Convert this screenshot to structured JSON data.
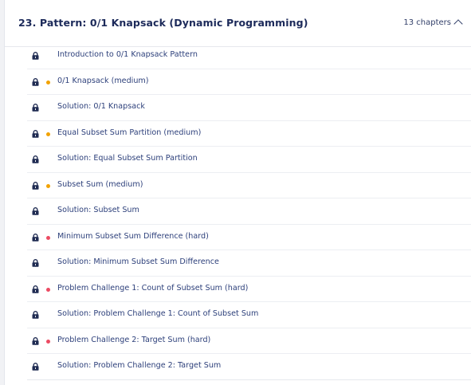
{
  "section": {
    "title": "23.  Pattern: 0/1 Knapsack (Dynamic Programming)",
    "chapters_label": "13 chapters",
    "toggle_icon": "chevron-up-icon"
  },
  "colors": {
    "medium": "#f2a200",
    "hard": "#ec4b63",
    "link": "#2c3f7a",
    "title": "#1c2a5a"
  },
  "lessons": [
    {
      "label": "Introduction to 0/1 Knapsack Pattern",
      "difficulty": "",
      "locked": true
    },
    {
      "label": "0/1 Knapsack (medium)",
      "difficulty": "medium",
      "locked": true
    },
    {
      "label": "Solution: 0/1 Knapsack",
      "difficulty": "",
      "locked": true
    },
    {
      "label": "Equal Subset Sum Partition (medium)",
      "difficulty": "medium",
      "locked": true
    },
    {
      "label": "Solution: Equal Subset Sum Partition",
      "difficulty": "",
      "locked": true
    },
    {
      "label": "Subset Sum (medium)",
      "difficulty": "medium",
      "locked": true
    },
    {
      "label": "Solution: Subset Sum",
      "difficulty": "",
      "locked": true
    },
    {
      "label": "Minimum Subset Sum Difference (hard)",
      "difficulty": "hard",
      "locked": true
    },
    {
      "label": "Solution: Minimum Subset Sum Difference",
      "difficulty": "",
      "locked": true
    },
    {
      "label": "Problem Challenge 1: Count of Subset Sum (hard)",
      "difficulty": "hard",
      "locked": true
    },
    {
      "label": "Solution: Problem Challenge 1: Count of Subset Sum",
      "difficulty": "",
      "locked": true
    },
    {
      "label": "Problem Challenge 2: Target Sum (hard)",
      "difficulty": "hard",
      "locked": true
    },
    {
      "label": "Solution: Problem Challenge 2: Target Sum",
      "difficulty": "",
      "locked": true
    }
  ]
}
